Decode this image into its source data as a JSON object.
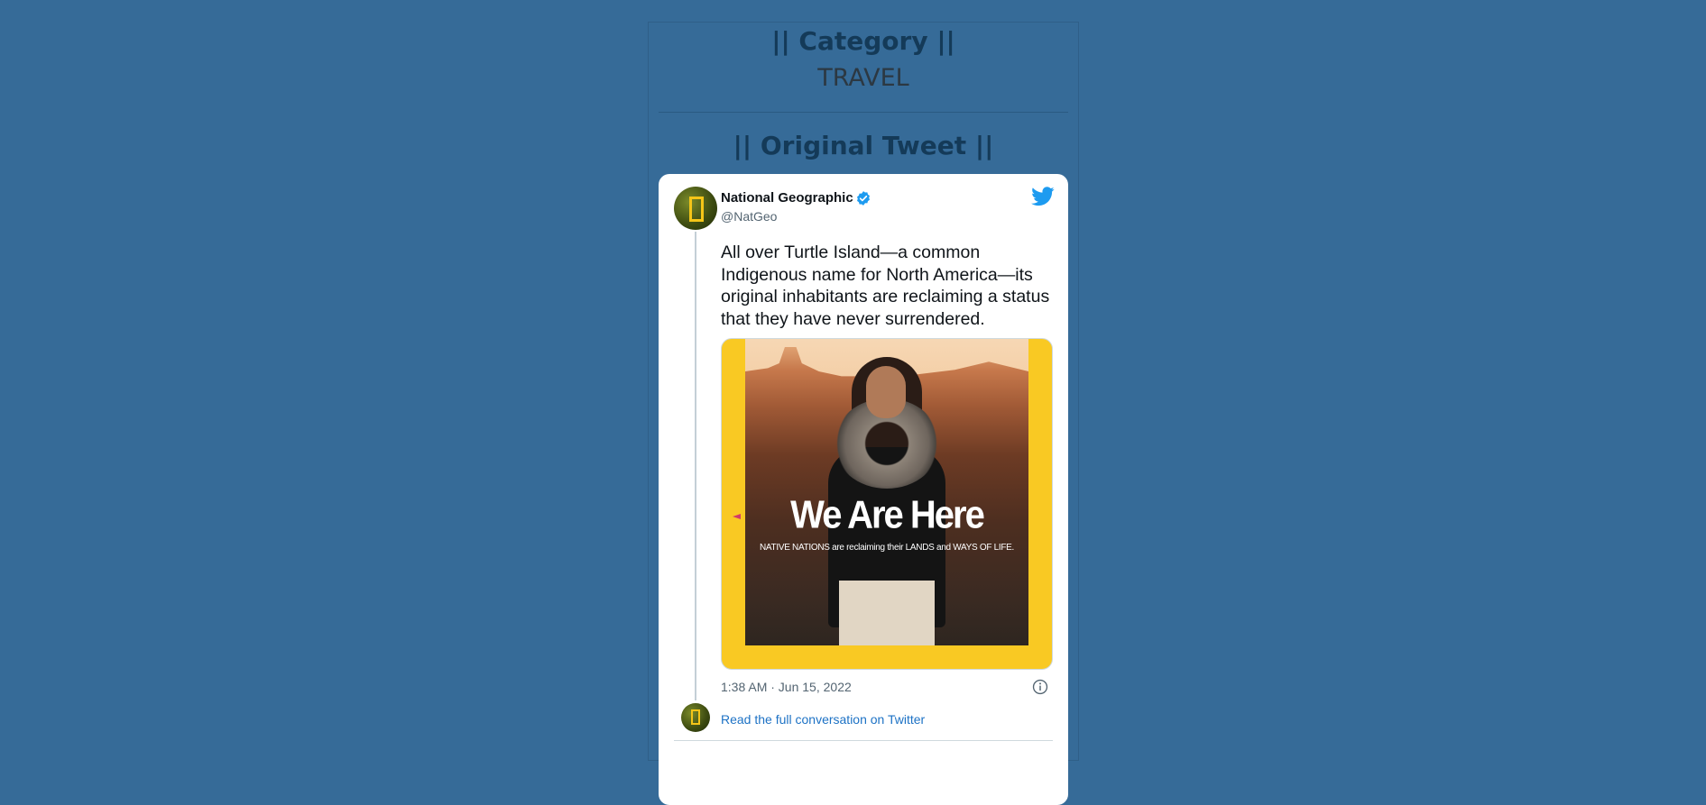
{
  "category": {
    "heading": "|| Category ||",
    "value": "TRAVEL"
  },
  "original_tweet": {
    "heading": "|| Original Tweet ||"
  },
  "tweet": {
    "author_name": "National Geographic",
    "handle": "@NatGeo",
    "verified": true,
    "text": "All over Turtle Island—a common Indigenous name for North America—its original inhabitants are reclaiming a status that they have never surrendered.",
    "media": {
      "title": "We Are Here",
      "subtitle": "NATIVE NATIONS are reclaiming their LANDS and WAYS OF LIFE."
    },
    "timestamp": "1:38 AM · Jun 15, 2022",
    "read_more_label": "Read the full conversation on Twitter"
  },
  "colors": {
    "page_background": "#366b98",
    "heading_text": "#143a58",
    "card_background": "#ffffff",
    "twitter_blue": "#1d9bf0",
    "natgeo_yellow": "#f9c923",
    "link": "#1d72c5"
  },
  "icons": {
    "verified": "verified-badge-icon",
    "twitter": "twitter-bird-icon",
    "info": "info-icon",
    "avatar": "natgeo-logo-avatar"
  }
}
